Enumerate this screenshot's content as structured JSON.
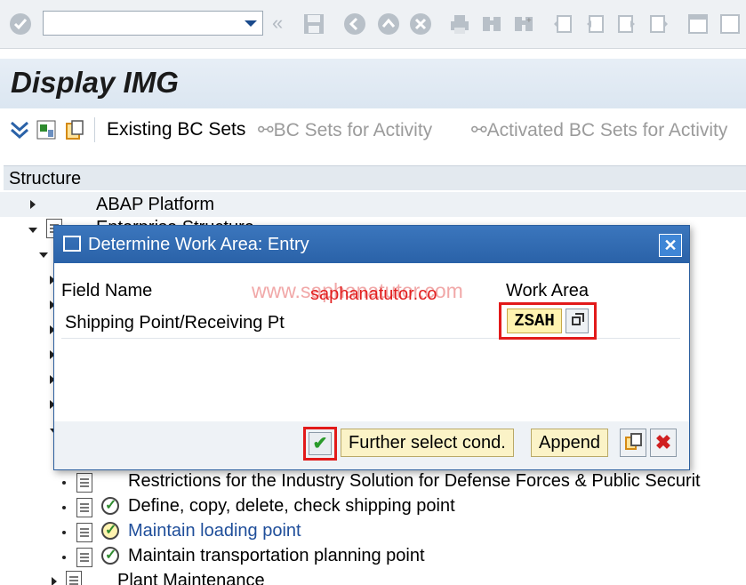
{
  "screen_title": "Display IMG",
  "toolbar": {
    "command_field_value": "",
    "icons": [
      "enter-icon",
      "back-double-icon",
      "save-icon",
      "back-icon",
      "exit-icon",
      "cancel-icon",
      "print-icon",
      "find-icon",
      "find-next-icon",
      "first-page-icon",
      "previous-page-icon",
      "next-page-icon",
      "last-page-icon",
      "create-session-icon",
      "shortcut-icon"
    ]
  },
  "app_toolbar": {
    "existing_bc_sets": "Existing BC Sets",
    "bc_sets_for_activity": "BC Sets for Activity",
    "activated_bc_sets_for_activity": "Activated BC Sets for Activity"
  },
  "tree": {
    "header": "Structure",
    "top_item": "ABAP Platform",
    "partial_item": "Enterprise Structure",
    "items": [
      {
        "label": "Restrictions for the Industry Solution for Defense Forces & Public Securit"
      },
      {
        "label": "Define, copy, delete, check shipping point"
      },
      {
        "label": "Maintain loading point"
      },
      {
        "label": "Maintain transportation planning point"
      }
    ],
    "bottom_item": "Plant Maintenance"
  },
  "dialog": {
    "title": "Determine Work Area: Entry",
    "col_field": "Field Name",
    "col_work_area": "Work Area",
    "watermark": "www.saphanatutor.com",
    "watermark_overlay": "saphanatutor.co",
    "row_label": "Shipping Point/Receiving Pt",
    "row_value": "ZSAH",
    "btn_further": "Further select cond.",
    "btn_append": "Append",
    "close": "✕",
    "ok": "✔",
    "cancel": "✖"
  },
  "colors": {
    "title_bar": "#2a62a8",
    "highlight_border": "#e21a1a",
    "button_bg": "#fbf3c7",
    "link_blue": "#1f4e9a"
  }
}
